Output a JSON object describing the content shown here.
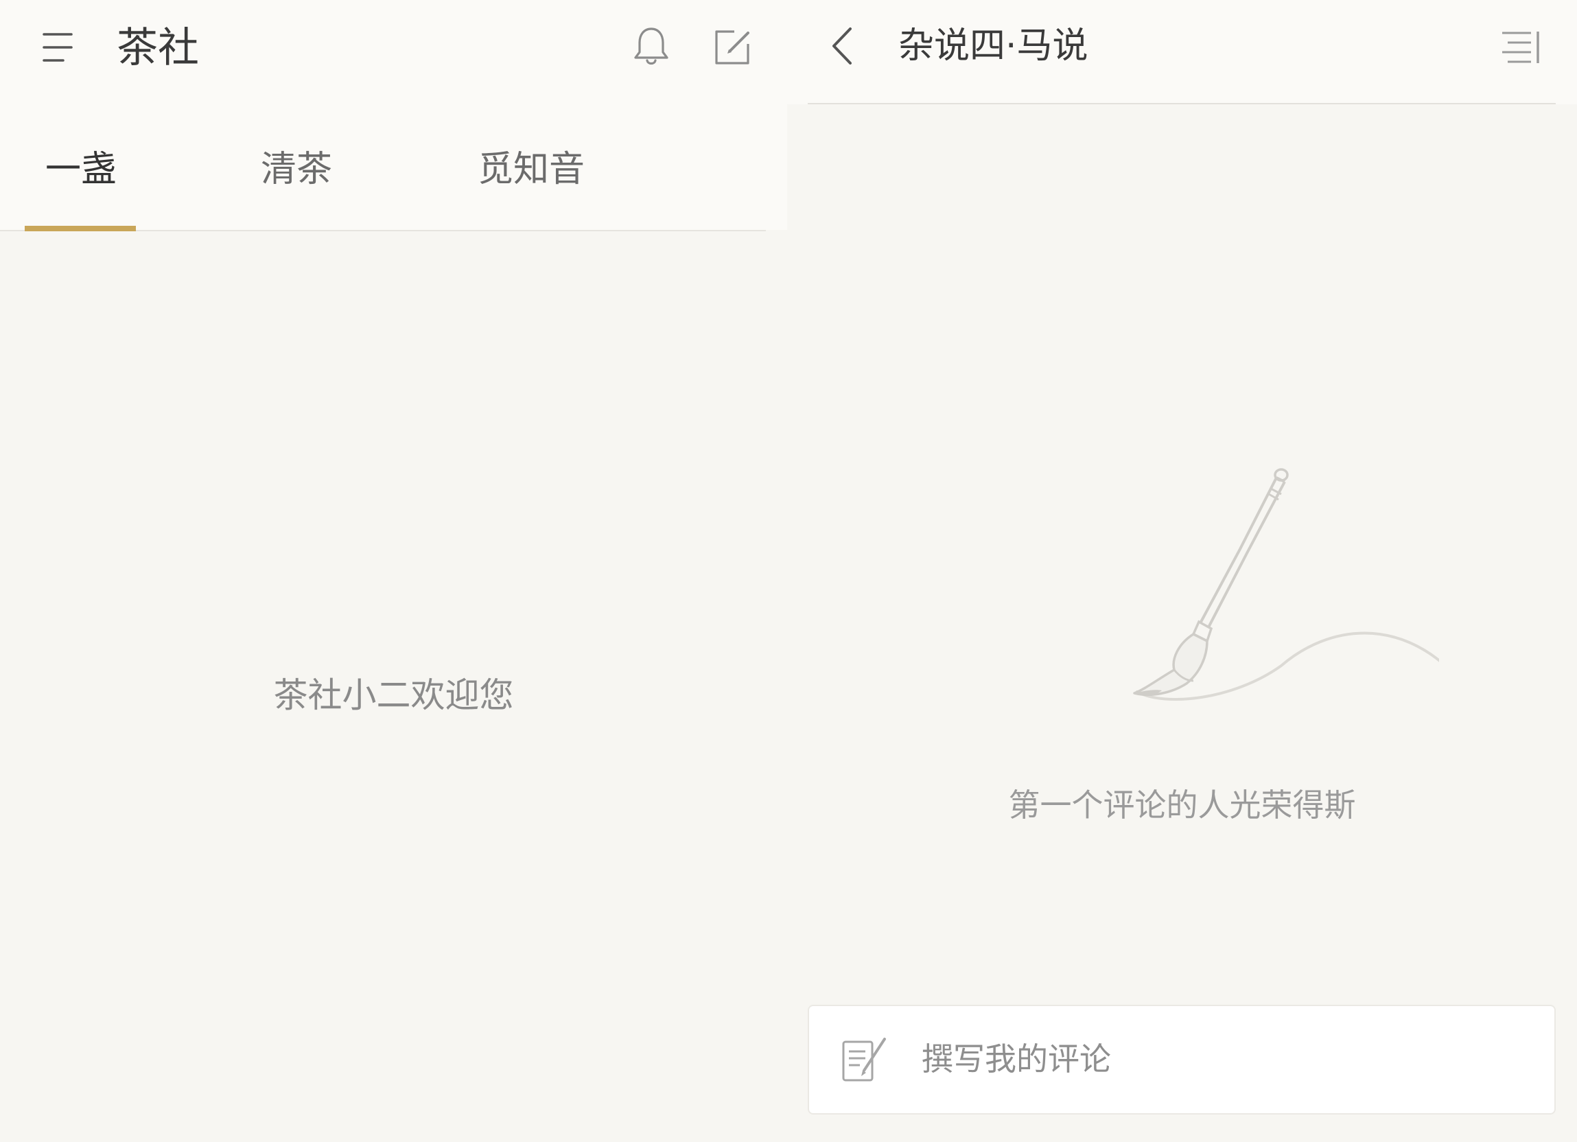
{
  "left": {
    "title": "茶社",
    "icons": {
      "menu": "menu-icon",
      "notifications": "bell-icon",
      "compose": "compose-icon"
    },
    "tabs": [
      {
        "label": "一盏",
        "active": true
      },
      {
        "label": "清茶",
        "active": false
      },
      {
        "label": "觅知音",
        "active": false
      }
    ],
    "welcome": "茶社小二欢迎您"
  },
  "right": {
    "title": "杂说四·马说",
    "icons": {
      "back": "chevron-left-icon",
      "outline": "outline-icon",
      "illustration": "brush-icon",
      "comment": "edit-note-icon"
    },
    "empty_state": "第一个评论的人光荣得斯",
    "comment_placeholder": "撰写我的评论"
  },
  "colors": {
    "background": "#f7f6f2",
    "topbar": "#fbfaf7",
    "accent": "#c9a659",
    "text_primary": "#333333",
    "text_secondary": "#8a8a8a"
  }
}
